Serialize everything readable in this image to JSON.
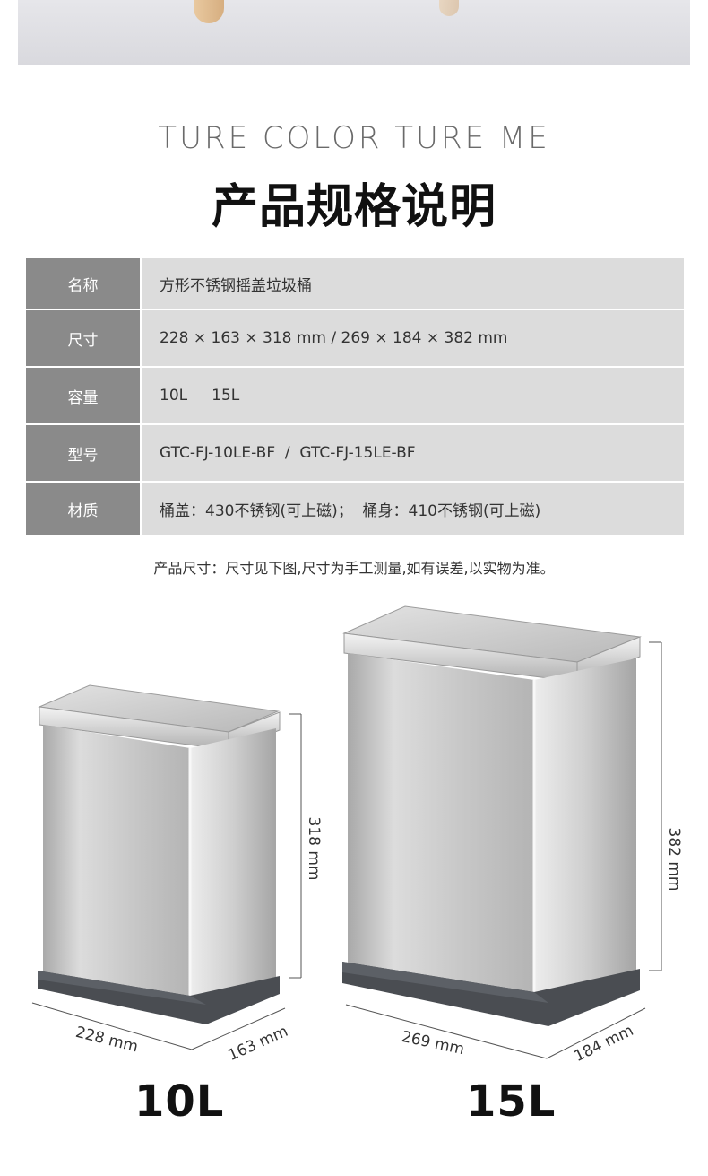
{
  "header": {
    "subtitle": "TURE COLOR TURE ME",
    "title": "产品规格说明"
  },
  "specs": [
    {
      "key": "名称",
      "value": "方形不锈钢摇盖垃圾桶"
    },
    {
      "key": "尺寸",
      "value": "228 × 163 × 318 mm  /  269 × 184 × 382 mm"
    },
    {
      "key": "容量",
      "value": "10L     15L"
    },
    {
      "key": "型号",
      "value": "GTC-FJ-10LE-BF  /  GTC-FJ-15LE-BF"
    },
    {
      "key": "材质",
      "value": "桶盖：430不锈钢(可上磁)；  桶身：410不锈钢(可上磁)"
    }
  ],
  "note": "产品尺寸：尺寸见下图,尺寸为手工测量,如有误差,以实物为准。",
  "bins": [
    {
      "capacity": "10L",
      "height_label": "318 mm",
      "width_label": "228 mm",
      "depth_label": "163 mm"
    },
    {
      "capacity": "15L",
      "height_label": "382 mm",
      "width_label": "269 mm",
      "depth_label": "184 mm"
    }
  ],
  "colors": {
    "table_key_bg": "#8a8a8a",
    "table_val_bg": "#dcdcdc",
    "steel_light": "#e8e8e8",
    "steel_dark": "#9a9a9a",
    "base": "#4a4d52"
  }
}
